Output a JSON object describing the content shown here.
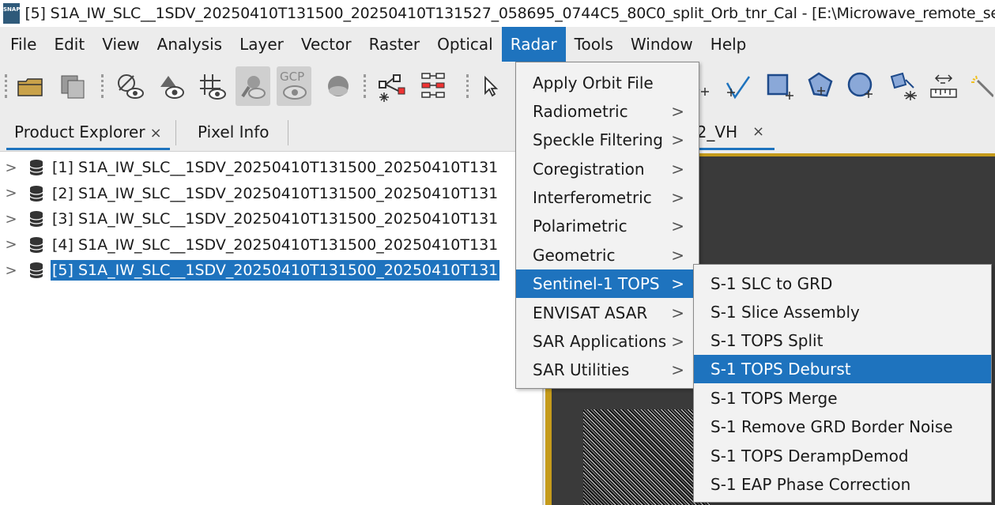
{
  "app": {
    "icon_text": "SNAP",
    "title": "[5] S1A_IW_SLC__1SDV_20250410T131500_20250410T131527_058695_0744C5_80C0_split_Orb_tnr_Cal - [E:\\Microwave_remote_sensing"
  },
  "menubar": [
    "File",
    "Edit",
    "View",
    "Analysis",
    "Layer",
    "Vector",
    "Raster",
    "Optical",
    "Radar",
    "Tools",
    "Window",
    "Help"
  ],
  "toolbar": {
    "gcp_label": "GCP",
    "icons": [
      "open-product-icon",
      "save-product-icon",
      "pin-manager-icon",
      "mask-view-icon",
      "graticule-icon",
      "world-map-icon",
      "gcp-manager-icon",
      "globe-icon",
      "graph-builder-icon",
      "batch-processing-icon",
      "select-tool-icon",
      "line-draw-icon",
      "polyline-draw-icon",
      "rectangle-draw-icon",
      "polygon-draw-icon",
      "ellipse-draw-icon",
      "insert-figure-icon",
      "range-finder-icon",
      "magic-wand-icon"
    ]
  },
  "left_panel": {
    "tabs": [
      {
        "label": "Product Explorer",
        "close": "×"
      },
      {
        "label": "Pixel Info"
      }
    ],
    "products": [
      "[1] S1A_IW_SLC__1SDV_20250410T131500_20250410T131",
      "[2] S1A_IW_SLC__1SDV_20250410T131500_20250410T131",
      "[3] S1A_IW_SLC__1SDV_20250410T131500_20250410T131",
      "[4] S1A_IW_SLC__1SDV_20250410T131500_20250410T131",
      "[5] S1A_IW_SLC__1SDV_20250410T131500_20250410T131"
    ]
  },
  "doc_tab": {
    "label": "V2_VH",
    "close": "×"
  },
  "radar_menu": {
    "items": [
      {
        "label": "Apply Orbit File",
        "submenu": false
      },
      {
        "label": "Radiometric",
        "submenu": true
      },
      {
        "label": "Speckle Filtering",
        "submenu": true
      },
      {
        "label": "Coregistration",
        "submenu": true
      },
      {
        "label": "Interferometric",
        "submenu": true
      },
      {
        "label": "Polarimetric",
        "submenu": true
      },
      {
        "label": "Geometric",
        "submenu": true
      },
      {
        "label": "Sentinel-1 TOPS",
        "submenu": true
      },
      {
        "label": "ENVISAT ASAR",
        "submenu": true
      },
      {
        "label": "SAR Applications",
        "submenu": true
      },
      {
        "label": "SAR Utilities",
        "submenu": true
      }
    ],
    "arrow": ">"
  },
  "tops_submenu": {
    "items": [
      "S-1 SLC to GRD",
      "S-1 Slice Assembly",
      "S-1 TOPS Split",
      "S-1 TOPS Deburst",
      "S-1 TOPS Merge",
      "S-1 Remove GRD Border Noise",
      "S-1 TOPS DerampDemod",
      "S-1 EAP Phase Correction"
    ]
  },
  "colors": {
    "accent": "#1e73be",
    "frame": "#c59b1b"
  }
}
